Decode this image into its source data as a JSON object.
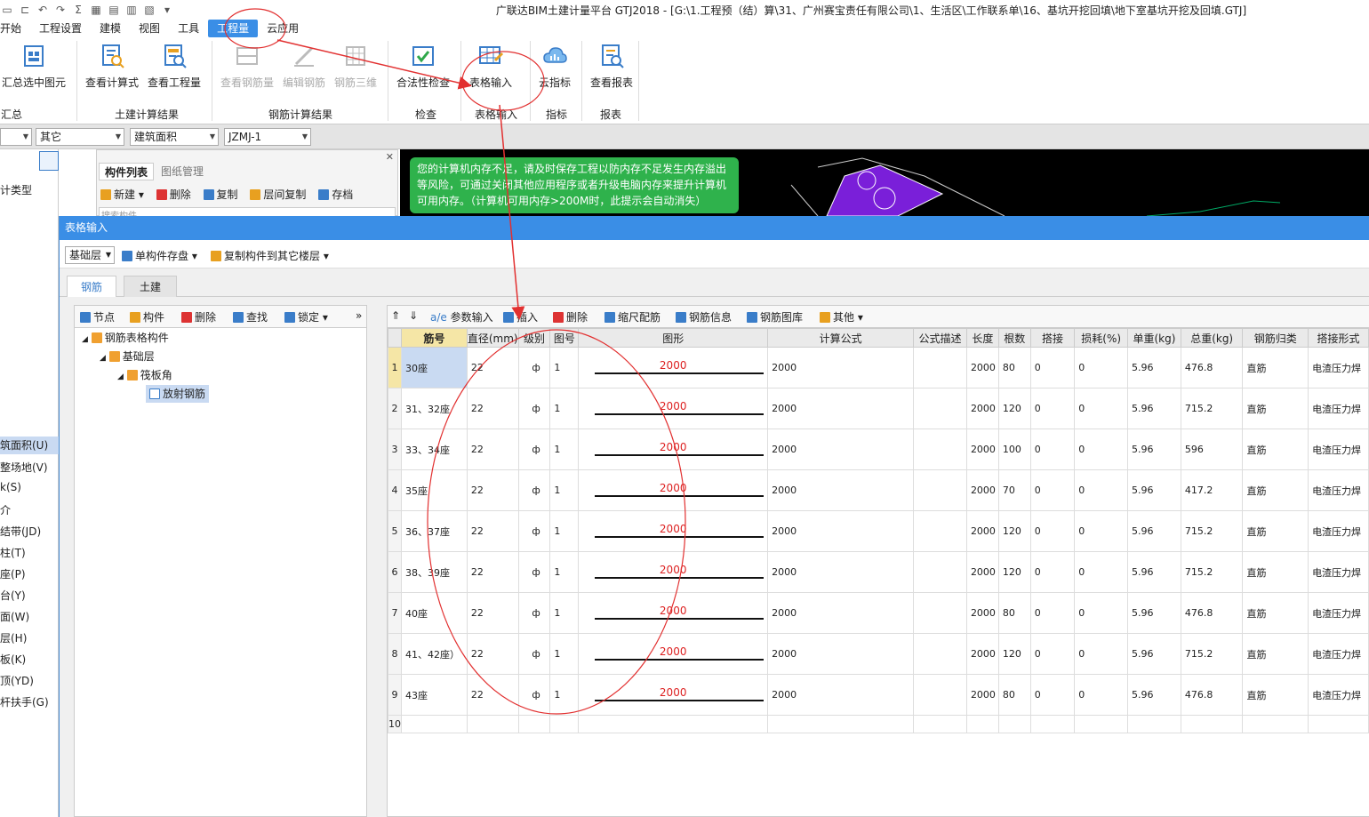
{
  "window": {
    "title": "广联达BIM土建计量平台 GTJ2018 - [G:\\1.工程预（结）算\\31、广州赛宝责任有限公司\\1、生活区\\工作联系单\\16、基坑开挖回填\\地下室基坑开挖及回填.GTJ]"
  },
  "menu": [
    "开始",
    "工程设置",
    "建模",
    "视图",
    "工具",
    "工程量",
    "云应用"
  ],
  "ribbon": {
    "buttons": {
      "summary": "汇总选中图元",
      "view_formula": "查看计算式",
      "view_quantity": "查看工程量",
      "view_rebar": "查看钢筋量",
      "edit_rebar": "编辑钢筋",
      "rebar_3d": "钢筋三维",
      "legality_check": "合法性检查",
      "table_input": "表格输入",
      "cloud_index": "云指标",
      "view_report": "查看报表"
    },
    "groups": {
      "summary": "汇总",
      "civil_results": "土建计算结果",
      "rebar_results": "钢筋计算结果",
      "check": "检查",
      "table_input": "表格输入",
      "index": "指标",
      "report": "报表"
    }
  },
  "combos": [
    "其它",
    "建筑面积",
    "JZMJ-1"
  ],
  "left_panel": {
    "items": [
      "计类型",
      "筑面积(U)",
      "整场地(V)",
      "k(S)",
      "介",
      "结带(JD)",
      "柱(T)",
      "座(P)",
      "台(Y)",
      "面(W)",
      "层(H)",
      "板(K)",
      "顶(YD)",
      "杆扶手(G)"
    ]
  },
  "component_list": {
    "tabs": [
      "构件列表",
      "图纸管理"
    ],
    "tools": [
      "新建",
      "删除",
      "复制",
      "层间复制",
      "存档"
    ],
    "search_placeholder": "搜索构件..."
  },
  "toast": "您的计算机内存不足，请及时保存工程以防内存不足发生内存溢出等风险，可通过关闭其他应用程序或者升级电脑内存来提升计算机可用内存。（计算机可用内存>200M时，此提示会自动消失）",
  "dialog": {
    "title": "表格输入",
    "floor": "基础层",
    "save_single": "单构件存盘",
    "copy_to_floors": "复制构件到其它楼层",
    "tabs": [
      "钢筋",
      "土建"
    ],
    "tree_tools": [
      "节点",
      "构件",
      "删除",
      "查找",
      "锁定"
    ],
    "tree": [
      "钢筋表格构件",
      "基础层",
      "筏板角",
      "放射钢筋"
    ],
    "grid_tools": [
      "参数输入",
      "插入",
      "删除",
      "缩尺配筋",
      "钢筋信息",
      "钢筋图库",
      "其他"
    ],
    "columns": [
      "筋号",
      "直径(mm)",
      "级别",
      "图号",
      "图形",
      "计算公式",
      "公式描述",
      "长度",
      "根数",
      "搭接",
      "损耗(%)",
      "单重(kg)",
      "总重(kg)",
      "钢筋归类",
      "搭接形式"
    ],
    "rows": [
      {
        "no": "1",
        "name": "30座",
        "dia": "22",
        "grade": "ф",
        "fig": "1",
        "shape": "2000",
        "formula": "2000",
        "desc": "",
        "len": "2000",
        "count": "80",
        "lap": "0",
        "loss": "0",
        "unit": "5.96",
        "total": "476.8",
        "cat": "直筋",
        "lap_type": "电渣压力焊"
      },
      {
        "no": "2",
        "name": "31、32座",
        "dia": "22",
        "grade": "ф",
        "fig": "1",
        "shape": "2000",
        "formula": "2000",
        "desc": "",
        "len": "2000",
        "count": "120",
        "lap": "0",
        "loss": "0",
        "unit": "5.96",
        "total": "715.2",
        "cat": "直筋",
        "lap_type": "电渣压力焊"
      },
      {
        "no": "3",
        "name": "33、34座",
        "dia": "22",
        "grade": "ф",
        "fig": "1",
        "shape": "2000",
        "formula": "2000",
        "desc": "",
        "len": "2000",
        "count": "100",
        "lap": "0",
        "loss": "0",
        "unit": "5.96",
        "total": "596",
        "cat": "直筋",
        "lap_type": "电渣压力焊"
      },
      {
        "no": "4",
        "name": "35座",
        "dia": "22",
        "grade": "ф",
        "fig": "1",
        "shape": "2000",
        "formula": "2000",
        "desc": "",
        "len": "2000",
        "count": "70",
        "lap": "0",
        "loss": "0",
        "unit": "5.96",
        "total": "417.2",
        "cat": "直筋",
        "lap_type": "电渣压力焊"
      },
      {
        "no": "5",
        "name": "36、37座",
        "dia": "22",
        "grade": "ф",
        "fig": "1",
        "shape": "2000",
        "formula": "2000",
        "desc": "",
        "len": "2000",
        "count": "120",
        "lap": "0",
        "loss": "0",
        "unit": "5.96",
        "total": "715.2",
        "cat": "直筋",
        "lap_type": "电渣压力焊"
      },
      {
        "no": "6",
        "name": "38、39座",
        "dia": "22",
        "grade": "ф",
        "fig": "1",
        "shape": "2000",
        "formula": "2000",
        "desc": "",
        "len": "2000",
        "count": "120",
        "lap": "0",
        "loss": "0",
        "unit": "5.96",
        "total": "715.2",
        "cat": "直筋",
        "lap_type": "电渣压力焊"
      },
      {
        "no": "7",
        "name": "40座",
        "dia": "22",
        "grade": "ф",
        "fig": "1",
        "shape": "2000",
        "formula": "2000",
        "desc": "",
        "len": "2000",
        "count": "80",
        "lap": "0",
        "loss": "0",
        "unit": "5.96",
        "total": "476.8",
        "cat": "直筋",
        "lap_type": "电渣压力焊"
      },
      {
        "no": "8",
        "name": "41、42座）",
        "dia": "22",
        "grade": "ф",
        "fig": "1",
        "shape": "2000",
        "formula": "2000",
        "desc": "",
        "len": "2000",
        "count": "120",
        "lap": "0",
        "loss": "0",
        "unit": "5.96",
        "total": "715.2",
        "cat": "直筋",
        "lap_type": "电渣压力焊"
      },
      {
        "no": "9",
        "name": "43座",
        "dia": "22",
        "grade": "ф",
        "fig": "1",
        "shape": "2000",
        "formula": "2000",
        "desc": "",
        "len": "2000",
        "count": "80",
        "lap": "0",
        "loss": "0",
        "unit": "5.96",
        "total": "476.8",
        "cat": "直筋",
        "lap_type": "电渣压力焊"
      }
    ],
    "empty_row_no": "10"
  },
  "colors": {
    "accent": "#3a8ee6",
    "toast": "#2fb24c",
    "annotation": "#e23030",
    "shape_text": "#d22222"
  }
}
